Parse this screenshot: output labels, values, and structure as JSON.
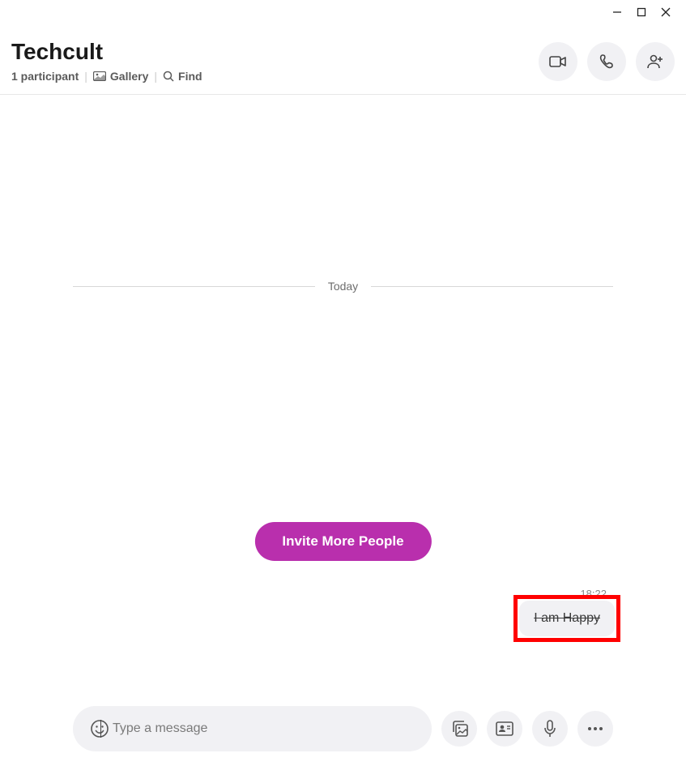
{
  "header": {
    "title": "Techcult",
    "participants": "1 participant",
    "gallery_label": "Gallery",
    "find_label": "Find"
  },
  "chat": {
    "date_separator": "Today",
    "invite_button": "Invite More People",
    "message": {
      "time": "18:22",
      "text": "I am Happy"
    }
  },
  "composer": {
    "placeholder": "Type a message"
  },
  "colors": {
    "accent": "#b92fad",
    "highlight": "#ff0000"
  }
}
